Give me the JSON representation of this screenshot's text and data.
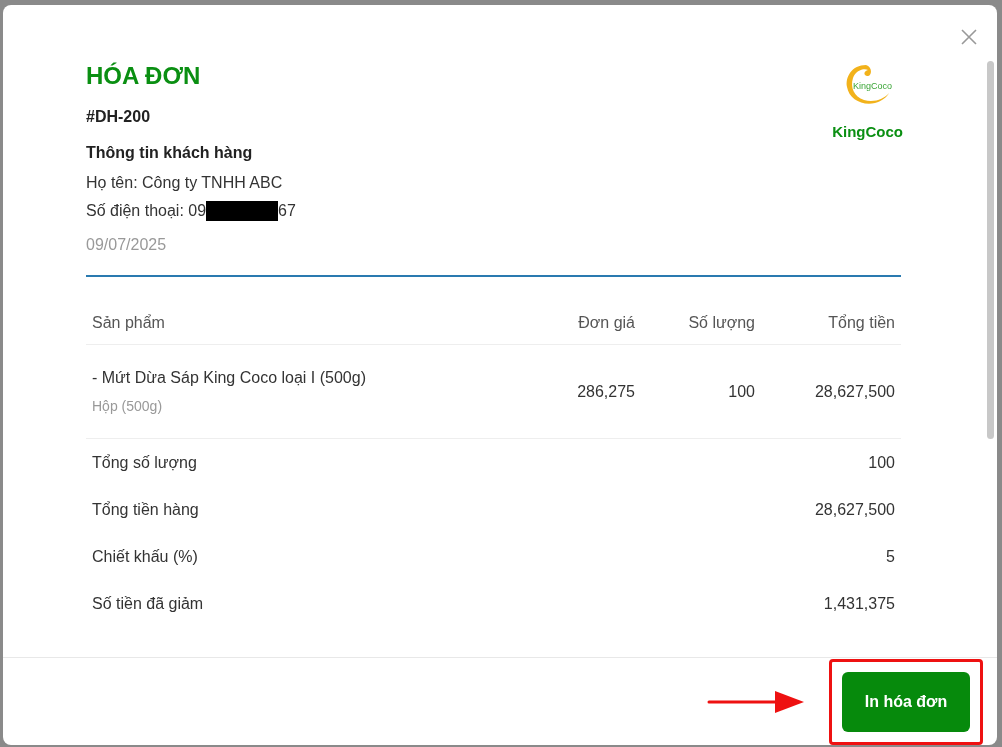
{
  "invoice": {
    "title": "HÓA ĐƠN",
    "order_code": "#DH-200",
    "customer_heading": "Thông tin khách hàng",
    "customer_name": "Họ tên: Công ty TNHH ABC",
    "phone_prefix": "Số điện thoại: 09",
    "phone_redacted": true,
    "phone_suffix": "67",
    "date": "09/07/2025",
    "logo_text": "KingCoco",
    "brand": "KingCoco"
  },
  "table": {
    "columns": [
      "Sản phẩm",
      "Đơn giá",
      "Số lượng",
      "Tổng tiền"
    ],
    "rows": [
      {
        "product": "- Mứt Dừa Sáp King Coco loại I (500g)",
        "unit": "Hộp (500g)",
        "price": "286,275",
        "quantity": "100",
        "total": "28,627,500"
      }
    ]
  },
  "summary": [
    {
      "label": "Tổng số lượng",
      "value": "100"
    },
    {
      "label": "Tổng tiền hàng",
      "value": "28,627,500"
    },
    {
      "label": "Chiết khấu (%)",
      "value": "5"
    },
    {
      "label": "Số tiền đã giảm",
      "value": "1,431,375"
    }
  ],
  "footer": {
    "print_button": "In hóa đơn",
    "highlighted": true
  }
}
